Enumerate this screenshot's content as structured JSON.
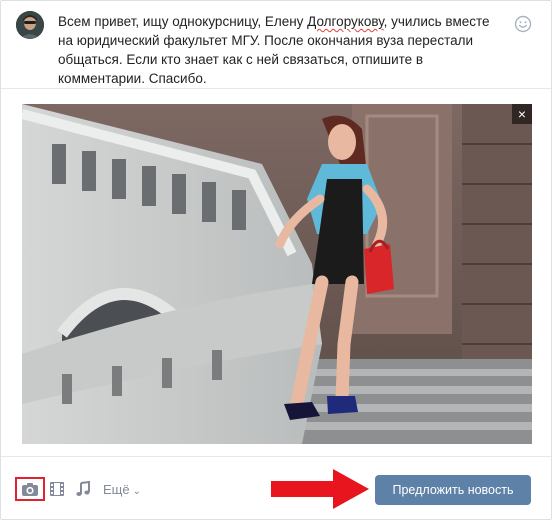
{
  "composer": {
    "text_before": "Всем привет, ищу однокурсницу, Елену ",
    "text_misspelled": "Долгорукову",
    "text_after": ", учились вместе на юридический факультет МГУ. После окончания вуза перестали общаться. Если кто знает как с ней связаться, отпишите в комментарии. Спасибо.",
    "emoji_icon": "smiley-icon"
  },
  "attachment": {
    "type": "photo",
    "close_label": "×",
    "close_icon": "close-icon"
  },
  "toolbar": {
    "icons": [
      "camera-icon",
      "film-icon",
      "music-note-icon"
    ],
    "more_label": "Ещё",
    "submit_label": "Предложить новость",
    "accent_color": "#5e81a8",
    "highlight_color": "#e0232e"
  }
}
